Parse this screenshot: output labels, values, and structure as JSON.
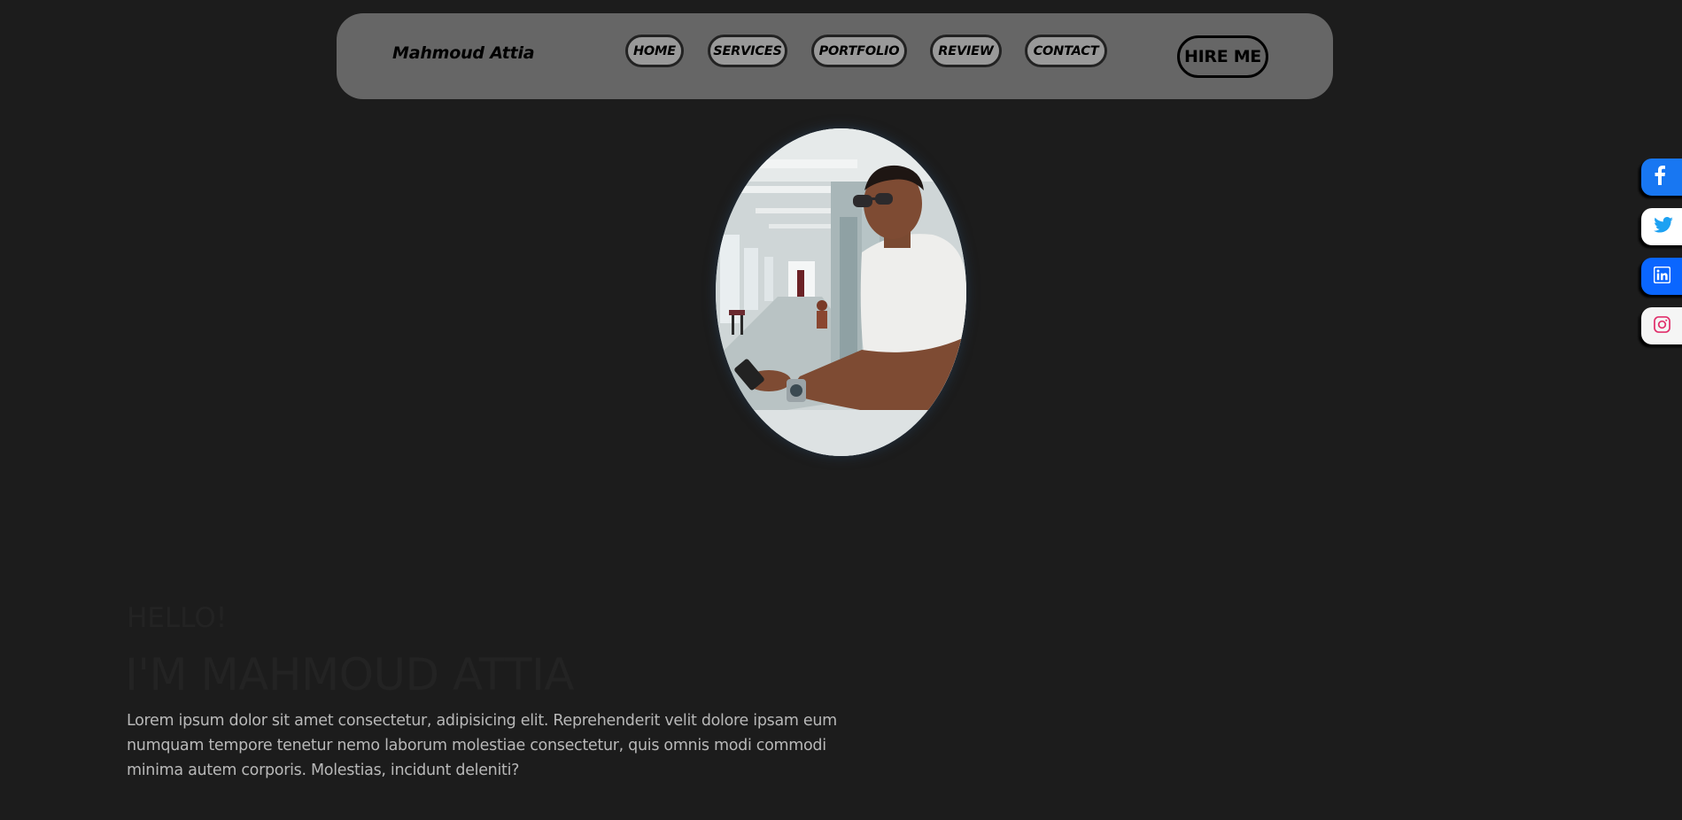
{
  "nav": {
    "brand": "Mahmoud Attia",
    "items": [
      {
        "label": "HOME"
      },
      {
        "label": "SERVICES"
      },
      {
        "label": "PORTFOLIO"
      },
      {
        "label": "REVIEW"
      },
      {
        "label": "CONTACT"
      }
    ],
    "hire_label": "HIRE ME"
  },
  "hero": {
    "greeting": "HELLO!",
    "headline": "I'M MAHMOUD ATTIA",
    "intro": "Lorem ipsum dolor sit amet consectetur, adipisicing elit. Reprehenderit velit dolore ipsam eum numquam tempore tenetur nemo laborum molestiae consectetur, quis omnis modi commodi minima autem corporis. Molestias, incidunt deleniti?"
  },
  "social": [
    {
      "icon": "facebook-icon",
      "color": "#1877f2"
    },
    {
      "icon": "twitter-icon",
      "color": "#1da1f2"
    },
    {
      "icon": "linkedin-icon",
      "color": "#0a66ff"
    },
    {
      "icon": "instagram-icon",
      "color": "#e1306c"
    }
  ],
  "colors": {
    "page_background": "#1c1c1c",
    "navbar_background": "#666666",
    "nav_pill_background": "#999999",
    "hero_title": "#232323",
    "hero_text": "#b8b8b8"
  }
}
